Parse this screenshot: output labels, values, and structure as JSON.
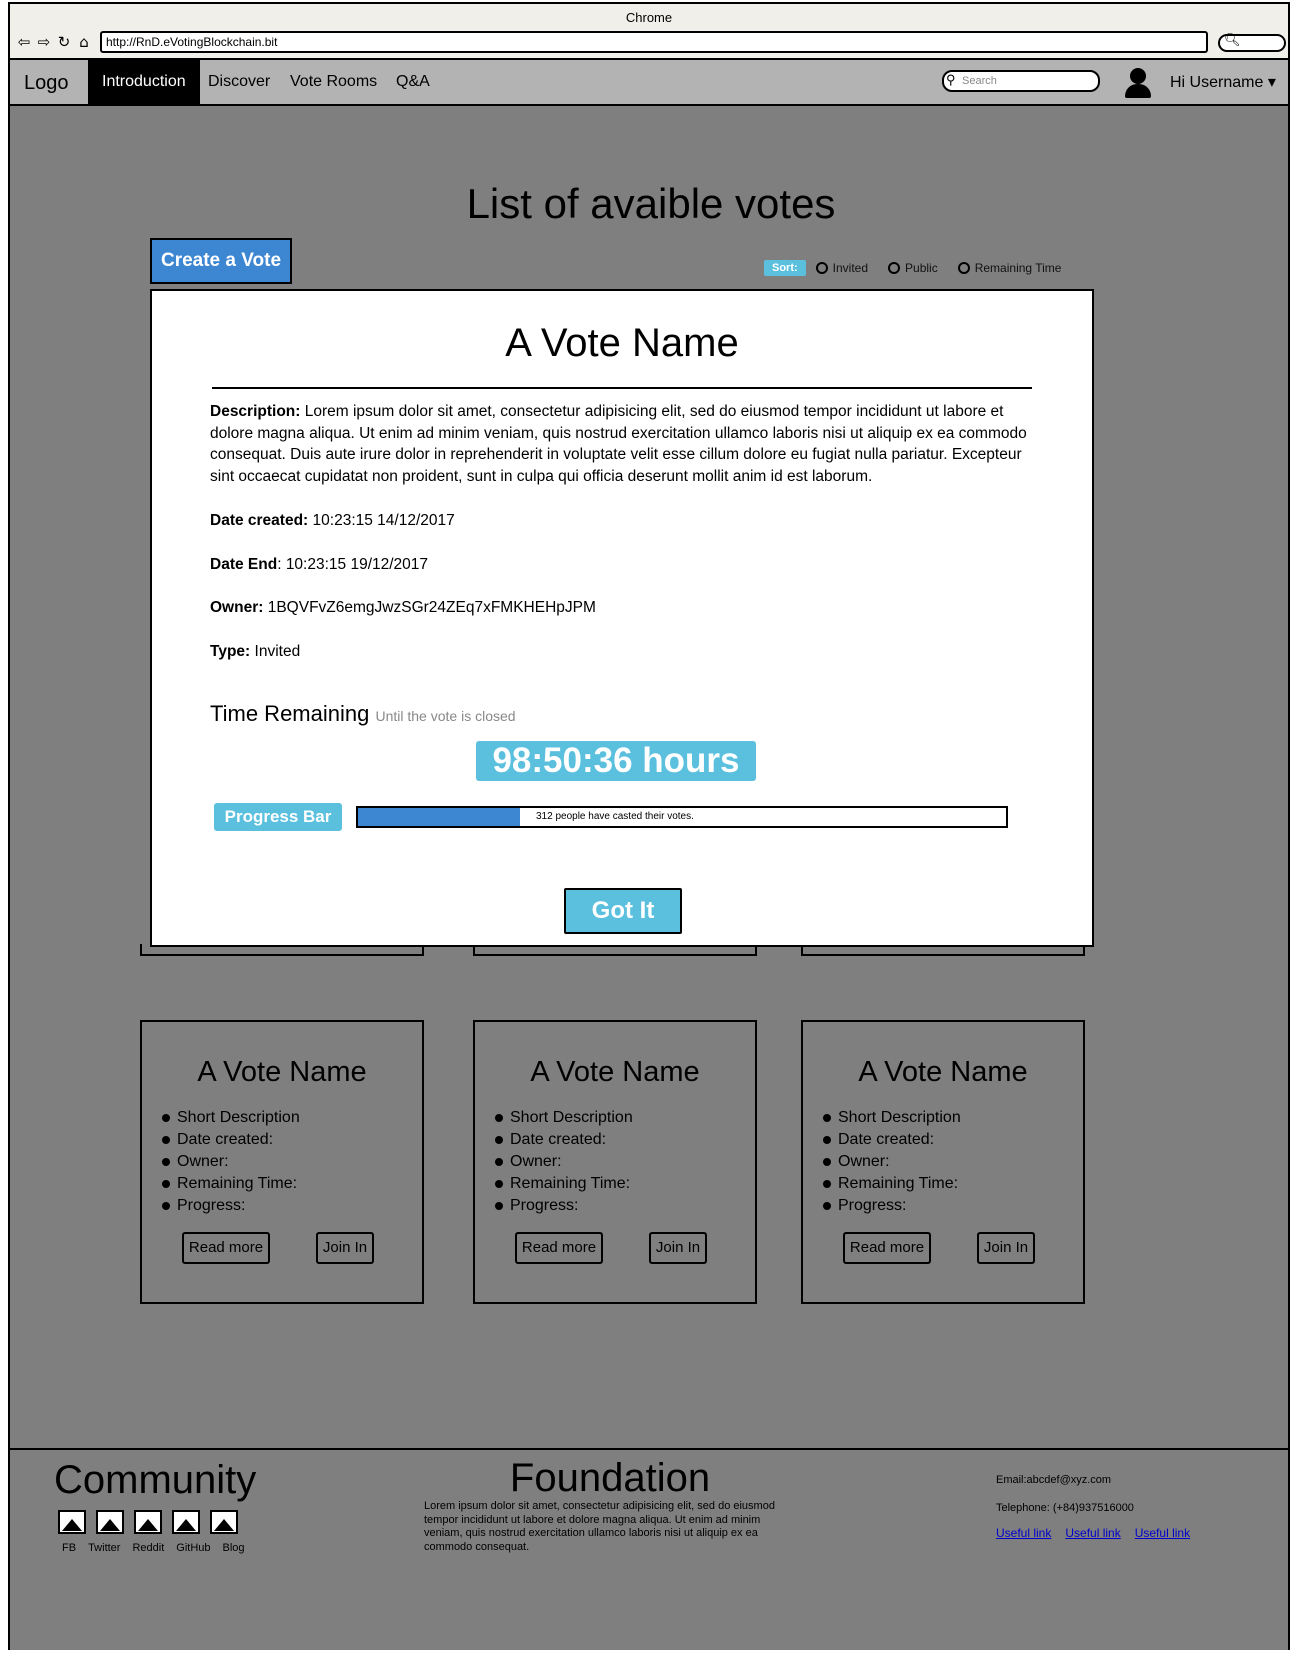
{
  "browser": {
    "title": "Chrome",
    "url": "http://RnD.eVotingBlockchain.bit"
  },
  "nav": {
    "logo": "Logo",
    "items": [
      {
        "label": "Introduction",
        "active": true
      },
      {
        "label": "Discover",
        "active": false
      },
      {
        "label": "Vote Rooms",
        "active": false
      },
      {
        "label": "Q&A",
        "active": false
      }
    ],
    "search_placeholder": "Search",
    "username": "Hi Username"
  },
  "page": {
    "heading": "List of avaible votes",
    "create_button": "Create a Vote",
    "sort_label": "Sort:",
    "sort_options": [
      "Invited",
      "Public",
      "Remaining Time"
    ]
  },
  "modal": {
    "title": "A Vote Name",
    "description_label": "Description:",
    "description": "Lorem ipsum dolor sit amet, consectetur adipisicing elit, sed do eiusmod tempor incididunt ut labore et dolore magna aliqua. Ut enim ad minim veniam, quis nostrud exercitation ullamco laboris nisi ut aliquip ex ea commodo consequat. Duis aute irure dolor in reprehenderit in voluptate velit esse cillum dolore eu fugiat nulla pariatur. Excepteur sint occaecat cupidatat non proident, sunt in culpa qui officia deserunt mollit anim id est laborum.",
    "date_created_label": "Date created:",
    "date_created": "10:23:15 14/12/2017",
    "date_end_label": "Date End",
    "date_end": "10:23:15  19/12/2017",
    "owner_label": "Owner:",
    "owner": "1BQVFvZ6emgJwzSGr24ZEq7xFMKHEHpJPM",
    "type_label": "Type:",
    "type": "Invited",
    "time_remaining_label": "Time Remaining",
    "time_remaining_hint": "Until the vote is closed",
    "countdown": "98:50:36 hours",
    "progress_label": "Progress Bar",
    "progress_text": "312 people have casted their votes.",
    "progress_fraction": 0.25,
    "got_it": "Got It"
  },
  "cards": [
    {
      "title": "A Vote Name",
      "bullets": [
        "Short Description",
        "Date created:",
        "Owner:",
        "Remaining Time:",
        "Progress:"
      ],
      "read_more": "Read more",
      "join": "Join In"
    },
    {
      "title": "A Vote Name",
      "bullets": [
        "Short Description",
        "Date created:",
        "Owner:",
        "Remaining Time:",
        "Progress:"
      ],
      "read_more": "Read more",
      "join": "Join In"
    },
    {
      "title": "A Vote Name",
      "bullets": [
        "Short Description",
        "Date created:",
        "Owner:",
        "Remaining Time:",
        "Progress:"
      ],
      "read_more": "Read more",
      "join": "Join In"
    }
  ],
  "footer": {
    "community_title": "Community",
    "social": [
      "FB",
      "Twitter",
      "Reddit",
      "GitHub",
      "Blog"
    ],
    "foundation_title": "Foundation",
    "foundation_text": "Lorem ipsum dolor sit amet, consectetur adipisicing elit, sed do eiusmod tempor incididunt ut labore et dolore magna aliqua. Ut enim ad minim veniam, quis nostrud exercitation ullamco laboris nisi ut aliquip ex ea commodo consequat.",
    "email": "Email:abcdef@xyz.com",
    "telephone": "Telephone: (+84)937516000",
    "links": [
      "Useful link",
      "Useful link",
      "Useful link"
    ]
  },
  "colors": {
    "background": "#7f7f7f",
    "primary_button": "#3d86d1",
    "accent": "#5bc0de",
    "nav_bar": "#b3b3b3"
  }
}
